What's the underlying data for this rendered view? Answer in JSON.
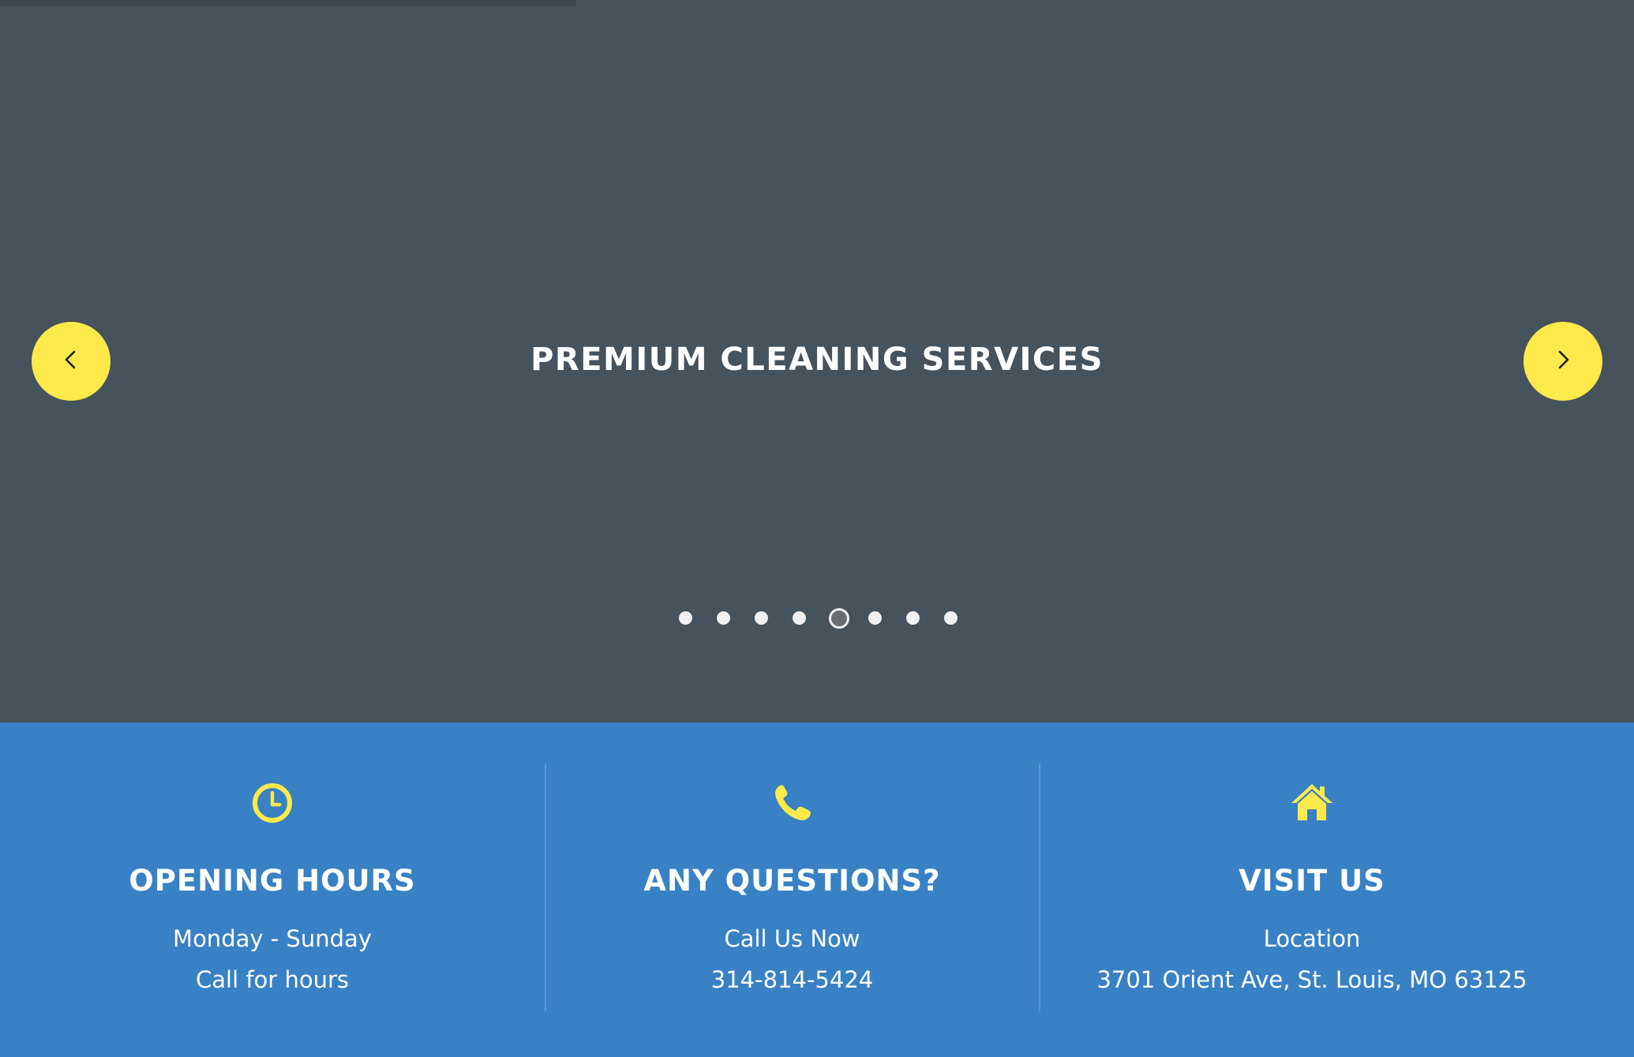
{
  "hero": {
    "title": "PREMIUM CLEANING SERVICES",
    "prev_icon": "chevron-left-icon",
    "next_icon": "chevron-right-icon",
    "slide_count": 8,
    "active_slide": 5,
    "colors": {
      "background": "#46525c",
      "accent": "#fde94a"
    }
  },
  "info": {
    "background": "#3881c5",
    "icon_color": "#fde94a",
    "columns": [
      {
        "icon": "clock-icon",
        "heading": "OPENING HOURS",
        "line1": "Monday - Sunday",
        "line2": "Call for hours"
      },
      {
        "icon": "phone-icon",
        "heading": "ANY QUESTIONS?",
        "line1": "Call Us Now",
        "line2": "314-814-5424"
      },
      {
        "icon": "home-icon",
        "heading": "VISIT US",
        "line1": "Location",
        "line2": "3701 Orient Ave, St. Louis, MO 63125"
      }
    ]
  }
}
